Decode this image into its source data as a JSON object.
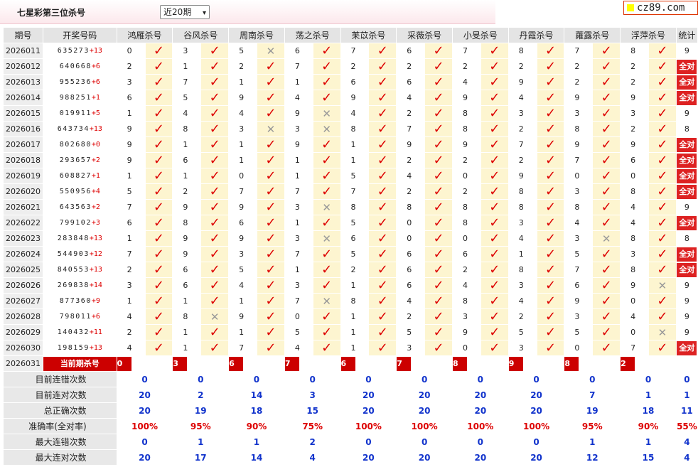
{
  "title": "七星彩第三位杀号",
  "period_select": "近20期",
  "logo": "cz89.com",
  "headers": [
    "期号",
    "开奖号码",
    "鸿雁杀号",
    "谷风杀号",
    "周南杀号",
    "荡之杀号",
    "苿苡杀号",
    "采薇杀号",
    "小旻杀号",
    "丹霞杀号",
    "蕹露杀号",
    "浮萍杀号",
    "统计"
  ],
  "experts": [
    "鸿雁",
    "谷风",
    "周南",
    "荡之",
    "苿苡",
    "采薇",
    "小旻",
    "丹霞",
    "蕹露",
    "浮萍"
  ],
  "all_correct_label": "全对",
  "rows": [
    {
      "period": "2026011",
      "digits": "635273",
      "bonus": "+13",
      "kills": [
        "0",
        "3",
        "5",
        "6",
        "7",
        "6",
        "7",
        "8",
        "7",
        "8"
      ],
      "hits": [
        1,
        1,
        0,
        1,
        1,
        1,
        1,
        1,
        1,
        1
      ],
      "total": "9"
    },
    {
      "period": "2026012",
      "digits": "640668",
      "bonus": "+6",
      "kills": [
        "2",
        "1",
        "2",
        "7",
        "2",
        "2",
        "2",
        "2",
        "2",
        "2"
      ],
      "hits": [
        1,
        1,
        1,
        1,
        1,
        1,
        1,
        1,
        1,
        1
      ],
      "total": "全对"
    },
    {
      "period": "2026013",
      "digits": "955236",
      "bonus": "+6",
      "kills": [
        "3",
        "7",
        "1",
        "1",
        "6",
        "6",
        "4",
        "9",
        "2",
        "2"
      ],
      "hits": [
        1,
        1,
        1,
        1,
        1,
        1,
        1,
        1,
        1,
        1
      ],
      "total": "全对"
    },
    {
      "period": "2026014",
      "digits": "988251",
      "bonus": "+1",
      "kills": [
        "6",
        "5",
        "9",
        "4",
        "9",
        "4",
        "9",
        "4",
        "9",
        "9"
      ],
      "hits": [
        1,
        1,
        1,
        1,
        1,
        1,
        1,
        1,
        1,
        1
      ],
      "total": "全对"
    },
    {
      "period": "2026015",
      "digits": "019911",
      "bonus": "+5",
      "kills": [
        "1",
        "4",
        "4",
        "9",
        "4",
        "2",
        "8",
        "3",
        "3",
        "3"
      ],
      "hits": [
        1,
        1,
        1,
        0,
        1,
        1,
        1,
        1,
        1,
        1
      ],
      "total": "9"
    },
    {
      "period": "2026016",
      "digits": "643734",
      "bonus": "+13",
      "kills": [
        "9",
        "8",
        "3",
        "3",
        "8",
        "7",
        "8",
        "2",
        "8",
        "2"
      ],
      "hits": [
        1,
        1,
        0,
        0,
        1,
        1,
        1,
        1,
        1,
        1
      ],
      "total": "8"
    },
    {
      "period": "2026017",
      "digits": "802680",
      "bonus": "+0",
      "kills": [
        "9",
        "1",
        "1",
        "9",
        "1",
        "9",
        "9",
        "7",
        "9",
        "9"
      ],
      "hits": [
        1,
        1,
        1,
        1,
        1,
        1,
        1,
        1,
        1,
        1
      ],
      "total": "全对"
    },
    {
      "period": "2026018",
      "digits": "293657",
      "bonus": "+2",
      "kills": [
        "9",
        "6",
        "1",
        "1",
        "1",
        "2",
        "2",
        "2",
        "7",
        "6"
      ],
      "hits": [
        1,
        1,
        1,
        1,
        1,
        1,
        1,
        1,
        1,
        1
      ],
      "total": "全对"
    },
    {
      "period": "2026019",
      "digits": "608827",
      "bonus": "+1",
      "kills": [
        "1",
        "1",
        "0",
        "1",
        "5",
        "4",
        "0",
        "9",
        "0",
        "0"
      ],
      "hits": [
        1,
        1,
        1,
        1,
        1,
        1,
        1,
        1,
        1,
        1
      ],
      "total": "全对"
    },
    {
      "period": "2026020",
      "digits": "550956",
      "bonus": "+4",
      "kills": [
        "5",
        "2",
        "7",
        "7",
        "7",
        "2",
        "2",
        "8",
        "3",
        "8"
      ],
      "hits": [
        1,
        1,
        1,
        1,
        1,
        1,
        1,
        1,
        1,
        1
      ],
      "total": "全对"
    },
    {
      "period": "2026021",
      "digits": "643563",
      "bonus": "+2",
      "kills": [
        "7",
        "9",
        "9",
        "3",
        "8",
        "8",
        "8",
        "8",
        "8",
        "4"
      ],
      "hits": [
        1,
        1,
        1,
        0,
        1,
        1,
        1,
        1,
        1,
        1
      ],
      "total": "9"
    },
    {
      "period": "2026022",
      "digits": "799102",
      "bonus": "+3",
      "kills": [
        "6",
        "8",
        "6",
        "1",
        "5",
        "0",
        "8",
        "3",
        "4",
        "4"
      ],
      "hits": [
        1,
        1,
        1,
        1,
        1,
        1,
        1,
        1,
        1,
        1
      ],
      "total": "全对"
    },
    {
      "period": "2026023",
      "digits": "283848",
      "bonus": "+13",
      "kills": [
        "1",
        "9",
        "9",
        "3",
        "6",
        "0",
        "0",
        "4",
        "3",
        "8"
      ],
      "hits": [
        1,
        1,
        1,
        0,
        1,
        1,
        1,
        1,
        0,
        1
      ],
      "total": "8"
    },
    {
      "period": "2026024",
      "digits": "544903",
      "bonus": "+12",
      "kills": [
        "7",
        "9",
        "3",
        "7",
        "5",
        "6",
        "6",
        "1",
        "5",
        "3"
      ],
      "hits": [
        1,
        1,
        1,
        1,
        1,
        1,
        1,
        1,
        1,
        1
      ],
      "total": "全对"
    },
    {
      "period": "2026025",
      "digits": "840553",
      "bonus": "+13",
      "kills": [
        "2",
        "6",
        "5",
        "1",
        "2",
        "6",
        "2",
        "8",
        "7",
        "8"
      ],
      "hits": [
        1,
        1,
        1,
        1,
        1,
        1,
        1,
        1,
        1,
        1
      ],
      "total": "全对"
    },
    {
      "period": "2026026",
      "digits": "269838",
      "bonus": "+14",
      "kills": [
        "3",
        "6",
        "4",
        "3",
        "1",
        "6",
        "4",
        "3",
        "6",
        "9"
      ],
      "hits": [
        1,
        1,
        1,
        1,
        1,
        1,
        1,
        1,
        1,
        0
      ],
      "total": "9"
    },
    {
      "period": "2026027",
      "digits": "877360",
      "bonus": "+9",
      "kills": [
        "1",
        "1",
        "1",
        "7",
        "8",
        "4",
        "8",
        "4",
        "9",
        "0"
      ],
      "hits": [
        1,
        1,
        1,
        0,
        1,
        1,
        1,
        1,
        1,
        1
      ],
      "total": "9"
    },
    {
      "period": "2026028",
      "digits": "798011",
      "bonus": "+6",
      "kills": [
        "4",
        "8",
        "9",
        "0",
        "1",
        "2",
        "3",
        "2",
        "3",
        "4"
      ],
      "hits": [
        1,
        0,
        1,
        1,
        1,
        1,
        1,
        1,
        1,
        1
      ],
      "total": "9"
    },
    {
      "period": "2026029",
      "digits": "140432",
      "bonus": "+11",
      "kills": [
        "2",
        "1",
        "1",
        "5",
        "1",
        "5",
        "9",
        "5",
        "5",
        "0"
      ],
      "hits": [
        1,
        1,
        1,
        1,
        1,
        1,
        1,
        1,
        1,
        0
      ],
      "total": "9"
    },
    {
      "period": "2026030",
      "digits": "198159",
      "bonus": "+13",
      "kills": [
        "4",
        "1",
        "7",
        "4",
        "1",
        "3",
        "0",
        "3",
        "0",
        "7"
      ],
      "hits": [
        1,
        1,
        1,
        1,
        1,
        1,
        1,
        1,
        1,
        1
      ],
      "total": "全对"
    }
  ],
  "current": {
    "period": "2026031",
    "label": "当前期杀号",
    "kills": [
      "0",
      "3",
      "6",
      "7",
      "6",
      "7",
      "8",
      "9",
      "8",
      "2"
    ]
  },
  "stats": [
    {
      "label": "目前连错次数",
      "values": [
        "0",
        "0",
        "0",
        "0",
        "0",
        "0",
        "0",
        "0",
        "0",
        "0",
        "0"
      ]
    },
    {
      "label": "目前连对次数",
      "values": [
        "20",
        "2",
        "14",
        "3",
        "20",
        "20",
        "20",
        "20",
        "7",
        "1",
        "1"
      ]
    },
    {
      "label": "总正确次数",
      "values": [
        "20",
        "19",
        "18",
        "15",
        "20",
        "20",
        "20",
        "20",
        "19",
        "18",
        "11"
      ]
    },
    {
      "label": "准确率(全对率)",
      "values": [
        "100%",
        "95%",
        "90%",
        "75%",
        "100%",
        "100%",
        "100%",
        "100%",
        "95%",
        "90%",
        "55%"
      ]
    },
    {
      "label": "最大连错次数",
      "values": [
        "0",
        "1",
        "1",
        "2",
        "0",
        "0",
        "0",
        "0",
        "1",
        "1",
        "4"
      ]
    },
    {
      "label": "最大连对次数",
      "values": [
        "20",
        "17",
        "14",
        "4",
        "20",
        "20",
        "20",
        "20",
        "12",
        "15",
        "4"
      ]
    }
  ]
}
